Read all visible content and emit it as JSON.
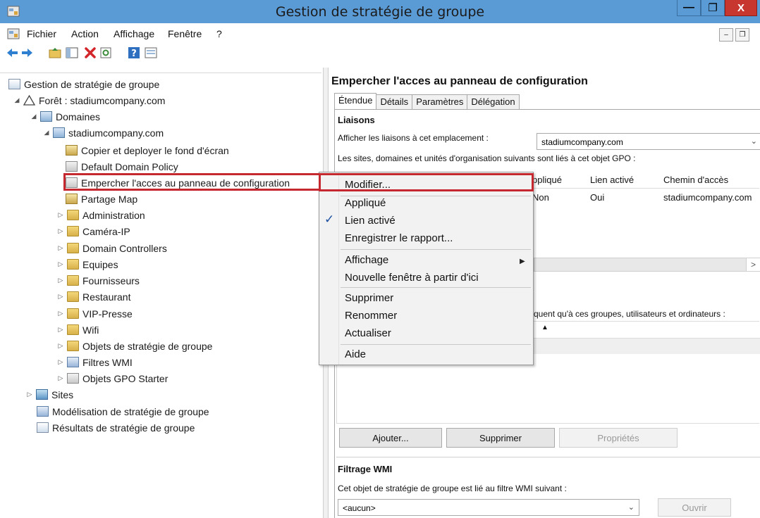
{
  "window": {
    "title": "Gestion de stratégie de groupe",
    "minimize": "—",
    "maximize": "❐",
    "close": "X"
  },
  "menubar": {
    "items": [
      "Fichier",
      "Action",
      "Affichage",
      "Fenêtre",
      "?"
    ],
    "mdi_minimize": "–",
    "mdi_restore": "❐"
  },
  "tree": {
    "root": "Gestion de stratégie de groupe",
    "forest": "Forêt : stadiumcompany.com",
    "domains": "Domaines",
    "domain": "stadiumcompany.com",
    "gpo_links": [
      "Copier et deployer le fond d'écran",
      "Default Domain Policy",
      "Empercher l'acces au panneau de configuration",
      "Partage Map"
    ],
    "ous": [
      "Administration",
      "Caméra-IP",
      "Domain Controllers",
      "Equipes",
      "Fournisseurs",
      "Restaurant",
      "VIP-Presse",
      "Wifi"
    ],
    "containers": [
      "Objets de stratégie de groupe",
      "Filtres WMI",
      "Objets GPO Starter"
    ],
    "sites": "Sites",
    "modeling": "Modélisation de stratégie de groupe",
    "results": "Résultats de stratégie de groupe"
  },
  "details": {
    "title": "Empercher l'acces au panneau de configuration",
    "tabs": [
      "Étendue",
      "Détails",
      "Paramètres",
      "Délégation"
    ],
    "links_section": "Liaisons",
    "show_links_label": "Afficher les liaisons à cet emplacement :",
    "show_links_value": "stadiumcompany.com",
    "linked_info": "Les sites, domaines et unités d'organisation suivants sont liés à cet objet GPO :",
    "columns": [
      "ppliqué",
      "Lien activé",
      "Chemin d'accès"
    ],
    "row": {
      "applied": "Non",
      "enabled": "Oui",
      "path": "stadiumcompany.com"
    },
    "scroll_right": ">",
    "security_info": "quent qu'à ces groupes, utilisateurs et ordinateurs :",
    "sort_indicator": "▲",
    "buttons": {
      "add": "Ajouter...",
      "remove": "Supprimer",
      "properties": "Propriétés"
    },
    "wmi_section": "Filtrage WMI",
    "wmi_info": "Cet objet de stratégie de groupe est lié au filtre WMI suivant :",
    "wmi_value": "<aucun>",
    "open_button": "Ouvrir"
  },
  "context_menu": {
    "items": [
      "Modifier...",
      "Appliqué",
      "Lien activé",
      "Enregistrer le rapport...",
      "Affichage",
      "Nouvelle fenêtre à partir d'ici",
      "Supprimer",
      "Renommer",
      "Actualiser",
      "Aide"
    ],
    "check": "✓",
    "submenu_arrow": "▶"
  },
  "colors": {
    "titlebar": "#5b9bd5",
    "close": "#c7372f",
    "highlight": "#c5282f"
  }
}
